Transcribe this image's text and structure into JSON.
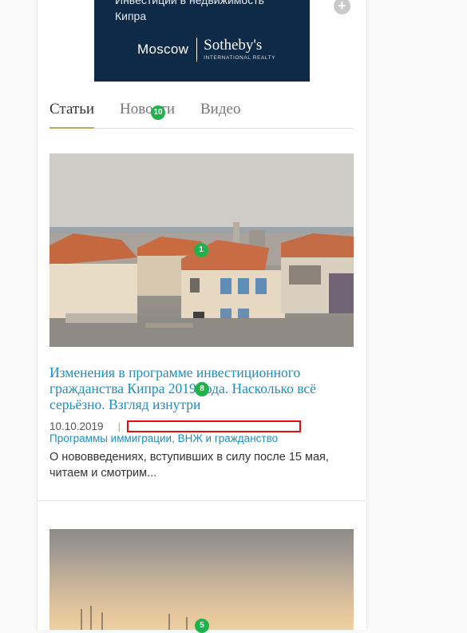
{
  "ad": {
    "text_line1": "Инвестиции в недвижимость",
    "text_line2": "Кипра",
    "city": "Moscow",
    "brand": "Sotheby's",
    "brand_sub": "INTERNATIONAL REALTY",
    "plus_label": "+"
  },
  "tabs": [
    {
      "label": "Статьи",
      "active": true
    },
    {
      "label": "Новости",
      "active": false
    },
    {
      "label": "Видео",
      "active": false
    }
  ],
  "article": {
    "title": "Изменения в программе инвестиционного гражданства Кипра 2019 года. Насколько всё серьёзно. Взгляд изнутри",
    "date": "10.10.2019",
    "separator": "|",
    "category": "Программы иммиграции, ВНЖ и гражданство",
    "excerpt": "О нововведениях, вступивших в силу после 15 мая, читаем и смотрим..."
  },
  "markers": {
    "m10": "10",
    "m1": "1",
    "m8": "8",
    "m5": "5"
  },
  "colors": {
    "link": "#1d8fc1",
    "accent": "#c8a460",
    "ad_bg": "#0e2a47",
    "marker": "#22b24c",
    "redaction": "#e01010"
  }
}
